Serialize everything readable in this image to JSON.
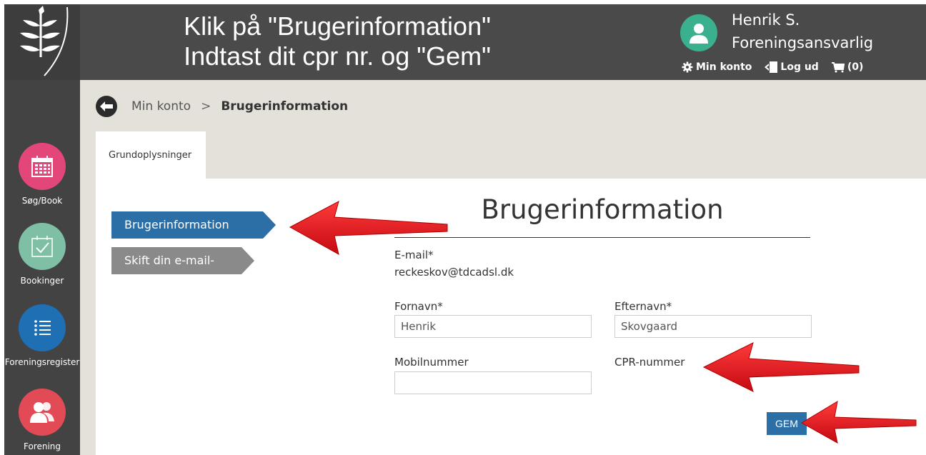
{
  "header": {
    "instruction_line1": "Klik på \"Brugerinformation\"",
    "instruction_line2": "Indtast dit cpr nr. og \"Gem\"",
    "user_name": "Henrik S.",
    "user_role": "Foreningsansvarlig",
    "account_label": "Min konto",
    "logout_label": "Log ud",
    "cart_label": "(0)"
  },
  "sidebar": {
    "items": [
      {
        "label": "Søg/Book",
        "color": "#e3477a",
        "icon": "calendar-icon"
      },
      {
        "label": "Bookinger",
        "color": "#7fbfa6",
        "icon": "calendar-check-icon"
      },
      {
        "label": "Foreningsregister",
        "color": "#1f6fb5",
        "icon": "list-icon"
      },
      {
        "label": "Forening",
        "color": "#e24b55",
        "icon": "people-icon"
      }
    ]
  },
  "breadcrumb": {
    "parent": "Min konto",
    "separator": ">",
    "current": "Brugerinformation"
  },
  "tabs": {
    "main": "Grundoplysninger"
  },
  "side_menu": {
    "active": "Brugerinformation",
    "other": "Skift din e-mail-adr..."
  },
  "form": {
    "title": "Brugerinformation",
    "email_label": "E-mail*",
    "email_value": "reckeskov@tdcadsl.dk",
    "firstname_label": "Fornavn*",
    "firstname_value": "Henrik",
    "lastname_label": "Efternavn*",
    "lastname_value": "Skovgaard",
    "mobile_label": "Mobilnummer",
    "mobile_value": "",
    "cpr_label": "CPR-nummer",
    "save_label": "GEM"
  },
  "colors": {
    "accent_blue": "#2c6fa6",
    "annotation_red": "#e0141e",
    "sidebar_bg": "#434343",
    "header_bg": "#4a4a4a",
    "main_bg": "#e3e1d9"
  }
}
